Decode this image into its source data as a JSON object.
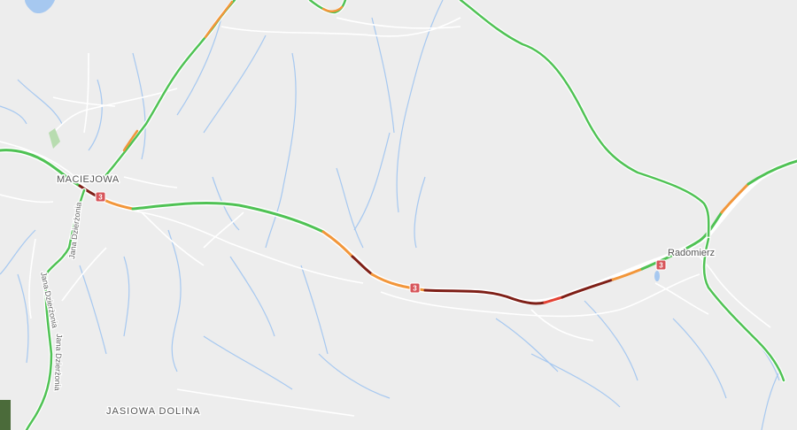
{
  "map": {
    "places": {
      "maciejowa": "MACIEJOWA",
      "radomierz": "Radomierz",
      "jasiowa_dolina": "JASIOWA DOLINA"
    },
    "streets": {
      "jana_dzierzonia_1": "Jana Dzierżonia",
      "jana_dzierzonia_2": "Jana Dzierżonia",
      "jana_dzierzonia_3": "Jana Dzierżonia"
    },
    "route_shield": "3",
    "colors": {
      "land": "#ededed",
      "water": "#a6c8f0",
      "road_minor": "#ffffff",
      "traffic_free": "#4fc254",
      "traffic_slow": "#f2963a",
      "traffic_heavy": "#e34133",
      "traffic_jam": "#7e1f17",
      "shield": "#d7555a"
    }
  }
}
